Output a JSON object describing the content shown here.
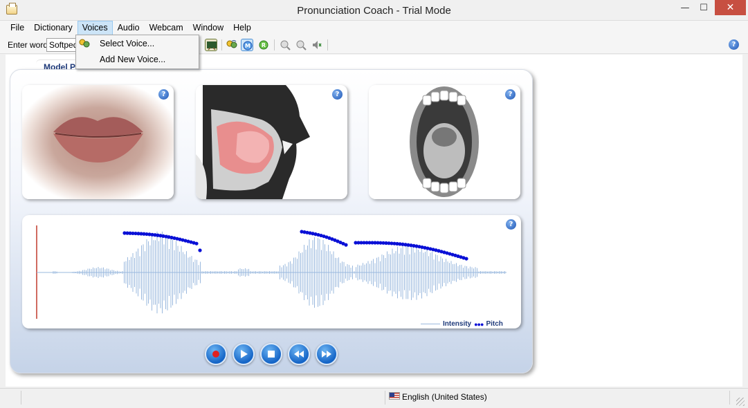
{
  "window": {
    "title": "Pronunciation Coach - Trial Mode"
  },
  "menu": {
    "items": [
      "File",
      "Dictionary",
      "Voices",
      "Audio",
      "Webcam",
      "Window",
      "Help"
    ],
    "active": "Voices",
    "voices_dropdown": [
      "Select Voice...",
      "Add New Voice..."
    ]
  },
  "toolbar": {
    "enter_word_label": "Enter word:",
    "word_value": "Softped"
  },
  "panel": {
    "title": "Model Pronunciation"
  },
  "waveform": {
    "legend_intensity": "Intensity",
    "legend_pitch": "Pitch",
    "intensity_color": "#9ab8de",
    "pitch_color": "#0a10d6"
  },
  "playback": [
    "record-button",
    "play-button",
    "stop-button",
    "rewind-button",
    "fast-forward-button"
  ],
  "status": {
    "language": "English (United States)"
  },
  "colors": {
    "accent": "#1565c7",
    "title_blue": "#1e3a7a",
    "close_red": "#c74f41"
  }
}
